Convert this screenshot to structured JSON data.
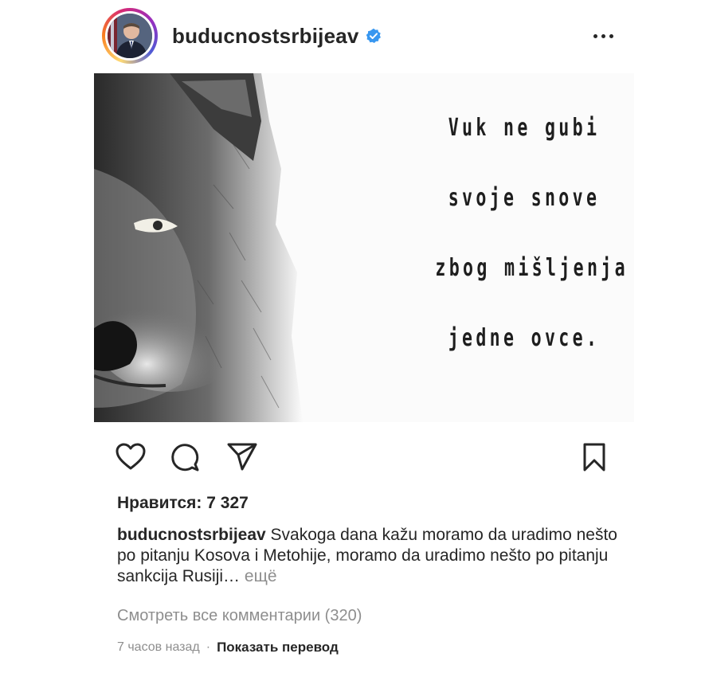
{
  "post": {
    "username": "buducnostsrbijeav",
    "verified_icon": "verified-badge-icon",
    "more_icon": "more-options-icon",
    "image": {
      "quote_lines": [
        "Vuk ne gubi",
        "svoje snove",
        "zbog mišljenja",
        "jedne ovce."
      ]
    },
    "actions": {
      "like_icon": "heart-icon",
      "comment_icon": "comment-icon",
      "share_icon": "send-icon",
      "save_icon": "bookmark-icon"
    },
    "likes_text": "Нравится: 7 327",
    "caption": {
      "user": "buducnostsrbijeav",
      "text": "Svakoga dana kažu moramo da uradimo nešto po pitanju Kosova i Metohije, moramo da uradimo nešto po pitanju sankcija Rusiji…",
      "more_label": "ещё"
    },
    "view_comments": "Смотреть все комментарии (320)",
    "time_ago": "7 часов назад",
    "separator": "·",
    "translate_label": "Показать перевод"
  },
  "colors": {
    "text": "#262626",
    "muted": "#8e8e8e",
    "verified": "#3897f0"
  }
}
